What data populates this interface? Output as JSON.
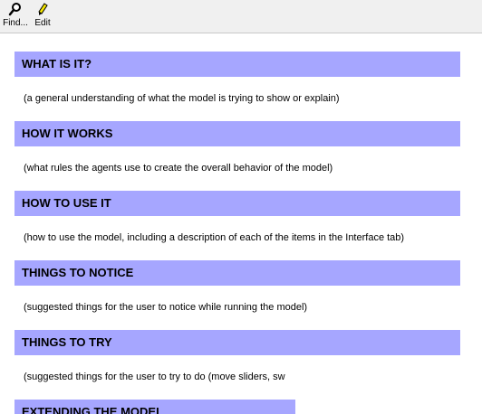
{
  "toolbar": {
    "find_label": "Find...",
    "edit_label": "Edit"
  },
  "sections": [
    {
      "title": "WHAT IS IT?",
      "body": "(a general understanding of what the model is trying to show or explain)"
    },
    {
      "title": "HOW IT WORKS",
      "body": "(what rules the agents use to create the overall behavior of the model)"
    },
    {
      "title": "HOW TO USE IT",
      "body": "(how to use the model, including a description of each of the items in the Interface tab)"
    },
    {
      "title": "THINGS TO NOTICE",
      "body": "(suggested things for the user to notice while running the model)"
    },
    {
      "title": "THINGS TO TRY",
      "body": "(suggested things for the user to try to do (move sliders, sw"
    },
    {
      "title": "EXTENDING THE MODEL",
      "body": ""
    }
  ],
  "colors": {
    "header_bg": "#a6a6ff",
    "toolbar_bg": "#f0f0f0"
  }
}
